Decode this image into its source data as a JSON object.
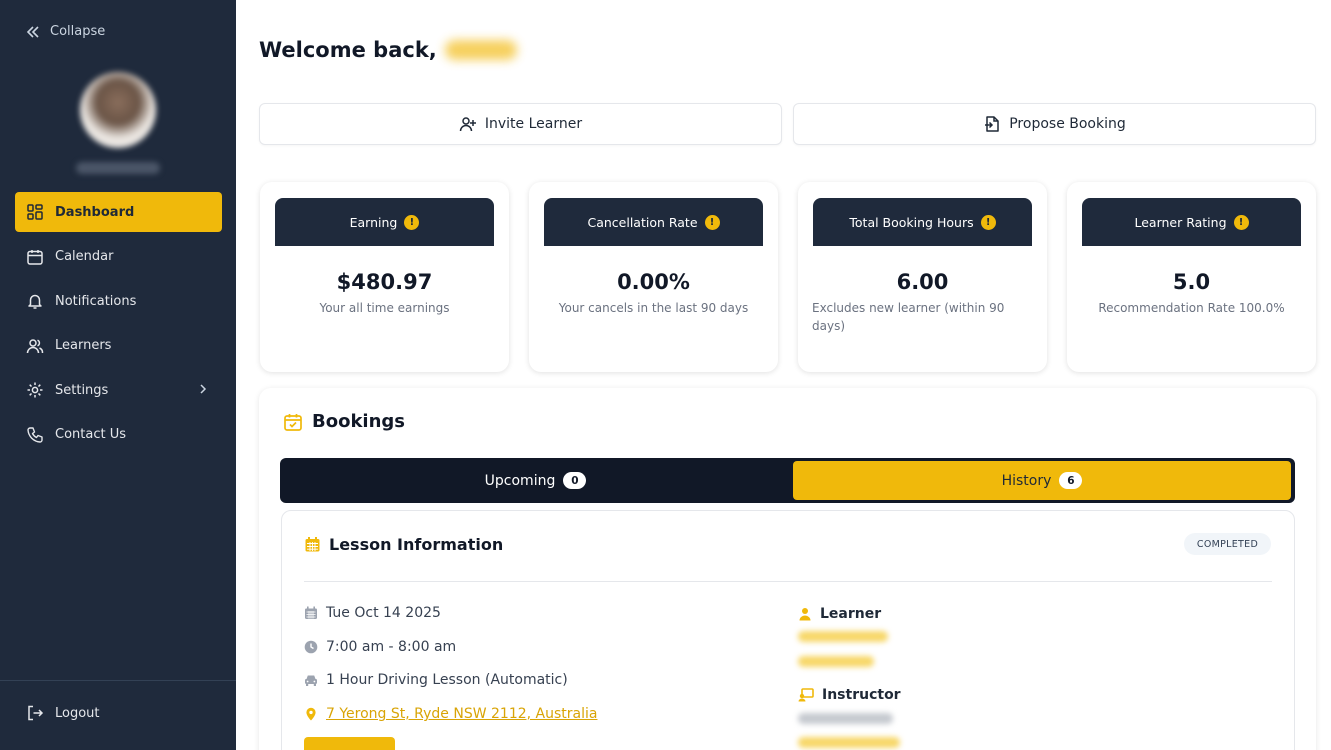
{
  "sidebar": {
    "collapse_label": "Collapse",
    "items": [
      {
        "label": "Dashboard",
        "icon": "grid-icon",
        "active": true
      },
      {
        "label": "Calendar",
        "icon": "calendar-icon"
      },
      {
        "label": "Notifications",
        "icon": "bell-icon"
      },
      {
        "label": "Learners",
        "icon": "users-icon"
      },
      {
        "label": "Settings",
        "icon": "gear-icon"
      },
      {
        "label": "Contact Us",
        "icon": "phone-icon"
      }
    ],
    "logout_label": "Logout"
  },
  "header": {
    "welcome": "Welcome back,"
  },
  "actions": {
    "invite_label": "Invite Learner",
    "propose_label": "Propose Booking"
  },
  "stats": [
    {
      "title": "Earning",
      "value": "$480.97",
      "subtitle": "Your all time earnings"
    },
    {
      "title": "Cancellation Rate",
      "value": "0.00%",
      "subtitle": "Your cancels in the last 90 days"
    },
    {
      "title": "Total Booking Hours",
      "value": "6.00",
      "subtitle": "Excludes new learner (within 90 days)"
    },
    {
      "title": "Learner Rating",
      "value": "5.0",
      "subtitle": "Recommendation Rate 100.0%"
    }
  ],
  "bookings": {
    "title": "Bookings",
    "tabs": [
      {
        "label": "Upcoming",
        "count": "0"
      },
      {
        "label": "History",
        "count": "6",
        "active": true
      }
    ],
    "lesson": {
      "title": "Lesson Information",
      "status": "COMPLETED",
      "date": "Tue Oct 14 2025",
      "time": "7:00 am - 8:00 am",
      "type": "1 Hour Driving Lesson (Automatic)",
      "address": "7 Yerong St, Ryde NSW 2112, Australia",
      "learner_label": "Learner",
      "instructor_label": "Instructor"
    }
  },
  "colors": {
    "sidebar_bg": "#1f2a3c",
    "accent": "#f0b90b",
    "tabs_bg": "#111827"
  }
}
